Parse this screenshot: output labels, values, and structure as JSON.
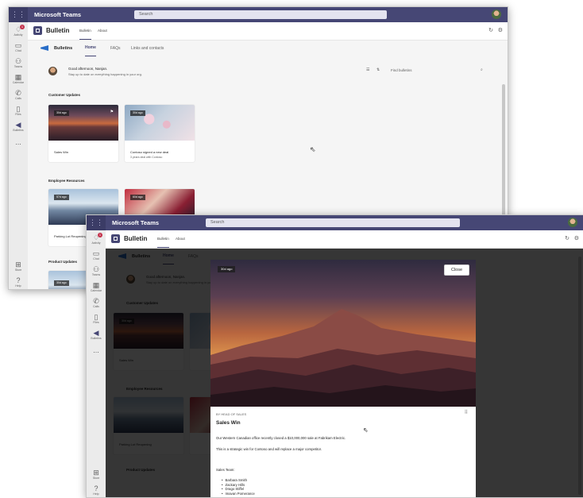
{
  "teams": {
    "app_name": "Microsoft Teams",
    "search_placeholder": "Search"
  },
  "rail": [
    {
      "label": "Activity",
      "icon": "bell-icon"
    },
    {
      "label": "Chat",
      "icon": "chat-icon"
    },
    {
      "label": "Teams",
      "icon": "teams-icon"
    },
    {
      "label": "Calendar",
      "icon": "calendar-icon"
    },
    {
      "label": "Calls",
      "icon": "phone-icon"
    },
    {
      "label": "Files",
      "icon": "file-icon"
    },
    {
      "label": "Bulletins",
      "icon": "bulletins-icon"
    },
    {
      "label": "Store",
      "icon": "store-icon"
    },
    {
      "label": "Help",
      "icon": "help-icon"
    }
  ],
  "rail_more": "...",
  "activity_badge": "1",
  "app_header": {
    "name": "Bulletin",
    "tabs": [
      "Bulletin",
      "About"
    ]
  },
  "subnav": {
    "title": "Bulletins",
    "tabs": [
      "Home",
      "FAQs",
      "Links and contacts"
    ]
  },
  "greeting": {
    "title": "Good afternoon, Nanjan.",
    "subtitle": "Stay up to date on everything happening in your org."
  },
  "find_placeholder": "Find bulletins",
  "sections": {
    "customer": {
      "title": "Customer Updates",
      "cards": [
        {
          "tag": "30d ago",
          "title": "Sales Win",
          "subtitle": ""
        },
        {
          "tag": "30d ago",
          "title": "Contoso signed a new deal",
          "subtitle": "3 years deal with Contoso"
        }
      ]
    },
    "employee": {
      "title": "Employee Resources",
      "cards": [
        {
          "tag": "57d ago",
          "title": "Parking Lot Reopening"
        },
        {
          "tag": "60d ago",
          "title": ""
        }
      ]
    },
    "product": {
      "title": "Product Updates",
      "cards": [
        {
          "tag": "30d ago"
        }
      ]
    }
  },
  "modal": {
    "tag": "30d ago",
    "close_label": "Close",
    "byline": "BY HEAD OF SALES",
    "title": "Sales Win",
    "body1": "Our Western Canadian office recently closed a $10,000,000 sale at Fabrikam Electric.",
    "body2": "This is a strategic win for Contoso and will replace a major competitor.",
    "team_label": "Sales Team:",
    "team": [
      "Barbara Smith",
      "Zackary Hills",
      "Drago Stiffel",
      "Imavan Pomerance"
    ]
  }
}
